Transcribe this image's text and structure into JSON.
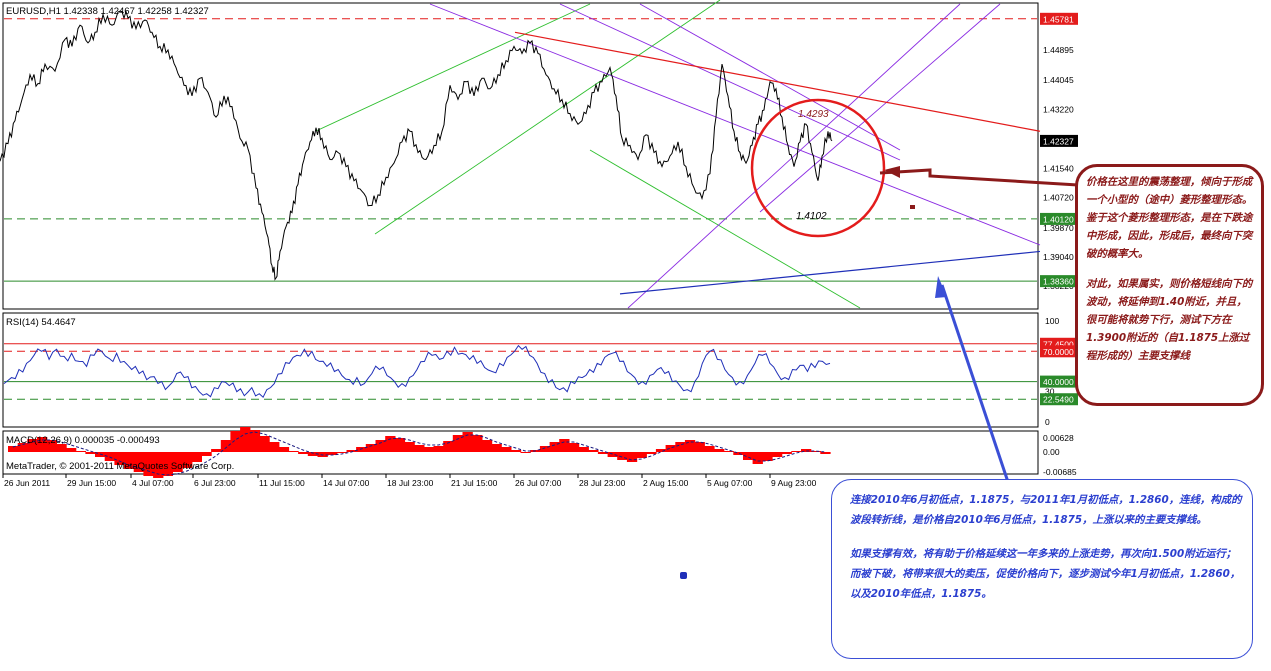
{
  "chart_data": [
    {
      "type": "line",
      "symbol_header": "EURUSD,H1  1.42338 1.42467 1.42258 1.42327",
      "ylim": [
        1.376,
        1.462
      ],
      "y_ticks": [
        "1.45781",
        "1.44895",
        "1.44045",
        "1.43220",
        "1.42327",
        "1.41540",
        "1.40720",
        "1.40120",
        "1.39870",
        "1.39040",
        "1.38360",
        "1.38220"
      ],
      "price_tags": [
        {
          "label": "1.45781",
          "value": 1.45781,
          "color": "#e31c1c"
        },
        {
          "label": "1.42327",
          "value": 1.42327,
          "color": "#000000"
        },
        {
          "label": "1.40120",
          "value": 1.4012,
          "color": "#2a8a2a"
        },
        {
          "label": "1.38360",
          "value": 1.3836,
          "color": "#2a8a2a"
        }
      ],
      "hlines": [
        {
          "value": 1.45781,
          "color": "#e31c1c",
          "dash": true
        },
        {
          "value": 1.4012,
          "color": "#2a8a2a",
          "dash": true
        },
        {
          "value": 1.3836,
          "color": "#2a8a2a",
          "dash": false
        }
      ],
      "annotations": [
        {
          "text": "1.4293",
          "x": 800,
          "y": 1.4293
        },
        {
          "text": "1.4102",
          "x": 796,
          "y": 1.4102
        }
      ],
      "x_labels": [
        "26 Jun 2011",
        "29 Jun 15:00",
        "4 Jul 07:00",
        "6 Jul 23:00",
        "11 Jul 15:00",
        "14 Jul 07:00",
        "18 Jul 23:00",
        "21 Jul 15:00",
        "26 Jul 07:00",
        "28 Jul 23:00",
        "2 Aug 15:00",
        "5 Aug 07:00",
        "9 Aug 23:00"
      ],
      "price_path": [
        [
          0,
          1.4175
        ],
        [
          8,
          1.4225
        ],
        [
          15,
          1.429
        ],
        [
          22,
          1.435
        ],
        [
          30,
          1.442
        ],
        [
          38,
          1.4395
        ],
        [
          45,
          1.445
        ],
        [
          55,
          1.443
        ],
        [
          65,
          1.452
        ],
        [
          72,
          1.45
        ],
        [
          80,
          1.456
        ],
        [
          88,
          1.451
        ],
        [
          95,
          1.454
        ],
        [
          103,
          1.459
        ],
        [
          112,
          1.456
        ],
        [
          120,
          1.46
        ],
        [
          128,
          1.458
        ],
        [
          136,
          1.455
        ],
        [
          145,
          1.4575
        ],
        [
          152,
          1.454
        ],
        [
          160,
          1.45
        ],
        [
          168,
          1.449
        ],
        [
          176,
          1.444
        ],
        [
          184,
          1.439
        ],
        [
          192,
          1.436
        ],
        [
          200,
          1.441
        ],
        [
          208,
          1.437
        ],
        [
          216,
          1.43
        ],
        [
          224,
          1.436
        ],
        [
          232,
          1.433
        ],
        [
          240,
          1.424
        ],
        [
          248,
          1.421
        ],
        [
          256,
          1.41
        ],
        [
          262,
          1.403
        ],
        [
          268,
          1.396
        ],
        [
          272,
          1.388
        ],
        [
          276,
          1.3845
        ],
        [
          280,
          1.392
        ],
        [
          286,
          1.399
        ],
        [
          292,
          1.403
        ],
        [
          298,
          1.411
        ],
        [
          304,
          1.418
        ],
        [
          310,
          1.423
        ],
        [
          316,
          1.427
        ],
        [
          322,
          1.424
        ],
        [
          330,
          1.418
        ],
        [
          338,
          1.42
        ],
        [
          346,
          1.416
        ],
        [
          354,
          1.412
        ],
        [
          362,
          1.409
        ],
        [
          370,
          1.405
        ],
        [
          378,
          1.408
        ],
        [
          386,
          1.413
        ],
        [
          394,
          1.417
        ],
        [
          402,
          1.423
        ],
        [
          410,
          1.426
        ],
        [
          418,
          1.42
        ],
        [
          426,
          1.418
        ],
        [
          434,
          1.422
        ],
        [
          442,
          1.426
        ],
        [
          450,
          1.439
        ],
        [
          458,
          1.435
        ],
        [
          466,
          1.44
        ],
        [
          474,
          1.436
        ],
        [
          482,
          1.441
        ],
        [
          490,
          1.438
        ],
        [
          498,
          1.442
        ],
        [
          506,
          1.446
        ],
        [
          514,
          1.45
        ],
        [
          522,
          1.448
        ],
        [
          530,
          1.451
        ],
        [
          538,
          1.448
        ],
        [
          546,
          1.442
        ],
        [
          554,
          1.438
        ],
        [
          562,
          1.435
        ],
        [
          570,
          1.431
        ],
        [
          578,
          1.428
        ],
        [
          586,
          1.431
        ],
        [
          594,
          1.437
        ],
        [
          602,
          1.44
        ],
        [
          610,
          1.444
        ],
        [
          616,
          1.436
        ],
        [
          622,
          1.424
        ],
        [
          630,
          1.422
        ],
        [
          638,
          1.418
        ],
        [
          646,
          1.425
        ],
        [
          654,
          1.42
        ],
        [
          662,
          1.416
        ],
        [
          670,
          1.419
        ],
        [
          678,
          1.423
        ],
        [
          686,
          1.416
        ],
        [
          694,
          1.41
        ],
        [
          702,
          1.407
        ],
        [
          710,
          1.414
        ],
        [
          716,
          1.43
        ],
        [
          722,
          1.445
        ],
        [
          728,
          1.436
        ],
        [
          734,
          1.426
        ],
        [
          740,
          1.42
        ],
        [
          746,
          1.417
        ],
        [
          752,
          1.422
        ],
        [
          758,
          1.428
        ],
        [
          764,
          1.432
        ],
        [
          770,
          1.44
        ],
        [
          776,
          1.438
        ],
        [
          782,
          1.43
        ],
        [
          788,
          1.422
        ],
        [
          794,
          1.416
        ],
        [
          800,
          1.423
        ],
        [
          806,
          1.428
        ],
        [
          812,
          1.42
        ],
        [
          818,
          1.412
        ],
        [
          822,
          1.419
        ],
        [
          828,
          1.426
        ],
        [
          832,
          1.4233
        ]
      ],
      "trendlines": [
        {
          "name": "red-resistance",
          "color": "#e31c1c",
          "from": [
            515,
            1.454
          ],
          "to": [
            1040,
            1.426
          ]
        },
        {
          "name": "blue-support",
          "color": "#1f2fb8",
          "from": [
            620,
            1.38
          ],
          "to": [
            1040,
            1.392
          ]
        }
      ]
    },
    {
      "type": "line",
      "label": "RSI(14) 54.4647",
      "ylim": [
        0,
        100
      ],
      "y_ticks": [
        "100",
        "77.4500",
        "70.0000",
        "40.0000",
        "30",
        "22.5490",
        "0"
      ],
      "levels": [
        {
          "value": 77.45,
          "color": "#e31c1c",
          "dash": false
        },
        {
          "value": 70,
          "color": "#e31c1c",
          "dash": true
        },
        {
          "value": 40,
          "color": "#2a8a2a",
          "dash": false
        },
        {
          "value": 22.549,
          "color": "#2a8a2a",
          "dash": true
        }
      ],
      "tags": [
        {
          "label": "77.4500",
          "value": 77.45,
          "color": "#e31c1c"
        },
        {
          "label": "70.0000",
          "value": 70,
          "color": "#e31c1c"
        },
        {
          "label": "40.0000",
          "value": 40,
          "color": "#2a8a2a"
        },
        {
          "label": "22.5490",
          "value": 22.549,
          "color": "#2a8a2a"
        }
      ],
      "values": [
        38,
        44,
        52,
        58,
        66,
        70,
        62,
        72,
        65,
        68,
        60,
        55,
        66,
        70,
        63,
        68,
        60,
        52,
        48,
        42,
        45,
        40,
        36,
        48,
        44,
        34,
        30,
        28,
        34,
        40,
        36,
        30,
        26,
        34,
        28,
        32,
        38,
        48,
        58,
        66,
        72,
        70,
        60,
        55,
        50,
        46,
        42,
        44,
        38,
        48,
        52,
        46,
        40,
        38,
        44,
        52,
        60,
        66,
        62,
        70,
        74,
        68,
        62,
        58,
        54,
        50,
        58,
        64,
        70,
        72,
        66,
        58,
        48,
        42,
        32,
        30,
        38,
        44,
        52,
        58,
        64,
        68,
        60,
        50,
        44,
        40,
        46,
        52,
        48,
        40,
        36,
        32,
        40,
        58,
        70,
        62,
        52,
        44,
        40,
        46,
        58,
        66,
        58,
        48,
        44,
        52,
        56,
        50,
        54,
        60,
        58
      ]
    },
    {
      "type": "bar",
      "label": "MACD(12,26,9) 0.000035 -0.000493",
      "ylim": [
        -0.00685,
        0.00628
      ],
      "y_ticks": [
        "0.00628",
        "0.00",
        "-0.00685"
      ],
      "values": [
        0.0012,
        0.0018,
        0.0026,
        0.003,
        0.0024,
        0.0016,
        0.0008,
        0.0002,
        -0.0004,
        -0.001,
        -0.0018,
        -0.0026,
        -0.0034,
        -0.004,
        -0.0048,
        -0.0052,
        -0.0048,
        -0.004,
        -0.0032,
        -0.002,
        -0.0008,
        0.0006,
        0.0024,
        0.0042,
        0.005,
        0.0044,
        0.0032,
        0.002,
        0.001,
        0.0002,
        -0.0004,
        -0.0008,
        -0.001,
        -0.0006,
        -0.0002,
        0.0004,
        0.001,
        0.0016,
        0.0024,
        0.0032,
        0.0028,
        0.002,
        0.0014,
        0.001,
        0.0012,
        0.0022,
        0.0034,
        0.004,
        0.0034,
        0.0024,
        0.0016,
        0.001,
        0.0004,
        -0.0002,
        0.0004,
        0.0012,
        0.002,
        0.0026,
        0.0018,
        0.001,
        0.0004,
        -0.0004,
        -0.001,
        -0.0016,
        -0.002,
        -0.0012,
        -0.0004,
        0.0006,
        0.0014,
        0.002,
        0.0024,
        0.002,
        0.0012,
        0.0006,
        0.0002,
        -0.0006,
        -0.0016,
        -0.0024,
        -0.0018,
        -0.001,
        -0.0004,
        0.0002,
        0.0006,
        0.0002,
        -0.0004
      ],
      "signal": [
        0.001,
        0.0015,
        0.002,
        0.0024,
        0.0024,
        0.002,
        0.0014,
        0.0008,
        0.0002,
        -0.0004,
        -0.001,
        -0.0018,
        -0.0026,
        -0.0032,
        -0.0038,
        -0.0044,
        -0.0046,
        -0.0044,
        -0.0038,
        -0.003,
        -0.002,
        -0.0008,
        0.0008,
        0.0024,
        0.0036,
        0.004,
        0.0036,
        0.0028,
        0.002,
        0.0012,
        0.0004,
        -0.0002,
        -0.0006,
        -0.0006,
        -0.0004,
        0.0,
        0.0006,
        0.0012,
        0.0018,
        0.0026,
        0.0028,
        0.0024,
        0.0018,
        0.0014,
        0.0014,
        0.0018,
        0.0026,
        0.0034,
        0.0034,
        0.0028,
        0.002,
        0.0014,
        0.0008,
        0.0002,
        0.0002,
        0.0008,
        0.0014,
        0.002,
        0.002,
        0.0014,
        0.0008,
        0.0002,
        -0.0004,
        -0.001,
        -0.0016,
        -0.0014,
        -0.0008,
        0.0,
        0.0008,
        0.0014,
        0.002,
        0.002,
        0.0016,
        0.001,
        0.0004,
        -0.0002,
        -0.001,
        -0.0018,
        -0.0018,
        -0.0014,
        -0.0008,
        -0.0002,
        0.0002,
        0.0002,
        0.0
      ],
      "footer_text": "MetaTrader, © 2001-2011 MetaQuotes Software Corp."
    }
  ],
  "notes": {
    "red_note": [
      "价格在这里的震荡整理，倾向于形成一个小型的（途中）菱形整理形态。鉴于这个菱形整理形态，是在下跌途中形成，因此，形成后，最终向下突破的概率大。",
      "对此，如果属实，则价格短线向下的波动，将延伸到1.40附近，并且，很可能将就势下行，测试下方在1.3900附近的（自1.1875上涨过程形成的）主要支撑线"
    ],
    "blue_note": [
      "连接2010年6月初低点，1.1875，与2011年1月初低点，1.2860，连线，构成的波段转折线，是价格自2010年6月低点，1.1875，上涨以来的主要支撑线。",
      "如果支撑有效，将有助于价格延续这一年多来的上涨走势，再次向1.500附近运行；\n而被下破，将带来很大的卖压，促使价格向下，逐步测试今年1月初低点，1.2860，以及2010年低点，1.1875。"
    ]
  },
  "colors": {
    "price_line": "#000000",
    "rsi_line": "#1f2fb8",
    "macd_hist": "#ff0000",
    "signal_line": "#1a1a80",
    "channel_green": "#2fbf2f",
    "channel_purple": "#8a2be2",
    "circle": "#e31c1c",
    "note_red": "#8b1a1a",
    "note_blue": "#3b4fd6"
  }
}
